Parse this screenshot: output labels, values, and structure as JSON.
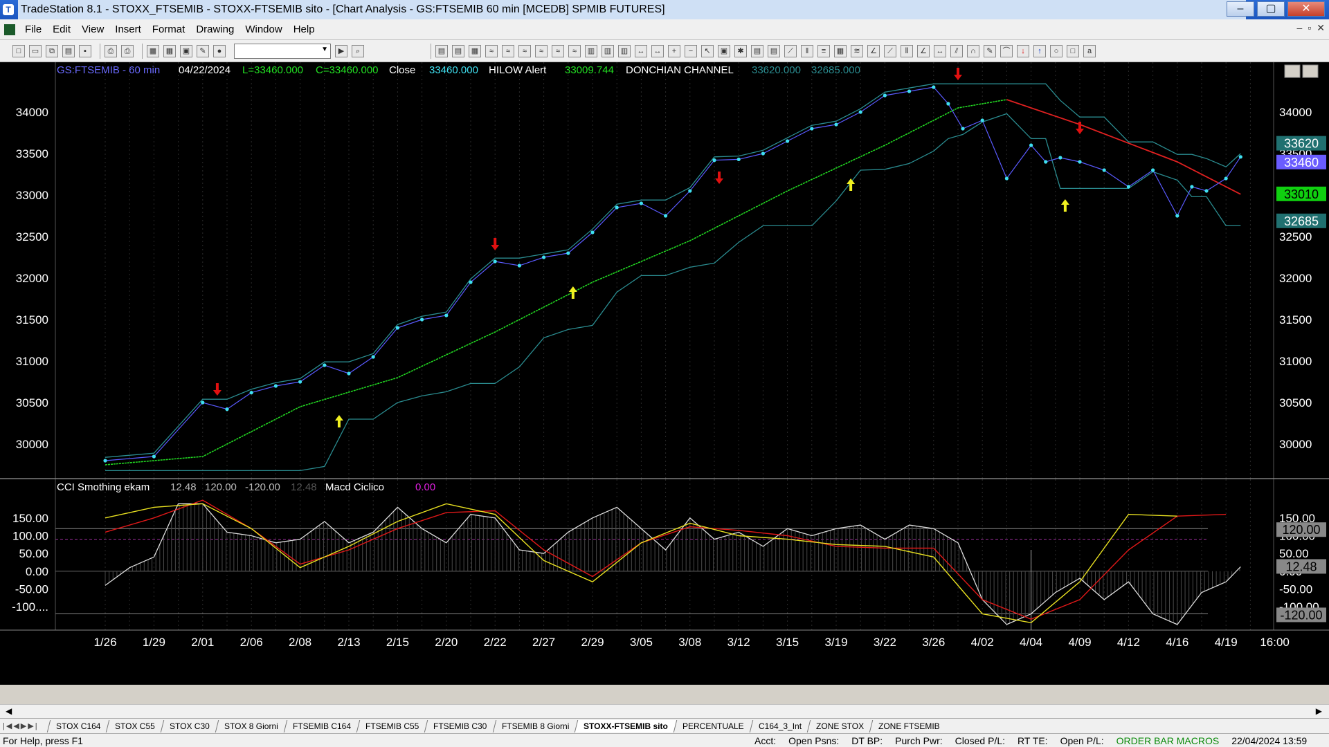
{
  "window": {
    "title": "TradeStation 8.1 - STOXX_FTSEMIB - STOXX-FTSEMIB sito - [Chart Analysis - GS:FTSEMIB  60 min  [MCEDB] SPMIB FUTURES]",
    "app_icon": "tradestation-icon"
  },
  "menu": [
    "File",
    "Edit",
    "View",
    "Insert",
    "Format",
    "Drawing",
    "Window",
    "Help"
  ],
  "price_panel": {
    "symbol": "GS:FTSEMIB - 60 min",
    "date": "04/22/2024",
    "low": "L=33460.000",
    "close_eq": "C=33460.000",
    "close_label": "Close",
    "close_val": "33460.000",
    "hilow_label": "HILOW Alert",
    "hilow_val": "33009.744",
    "donchian_label": "DONCHIAN CHANNEL",
    "donchian_hi": "33620.000",
    "donchian_lo": "32685.000",
    "badge_hi": "33620",
    "badge_close": "33460",
    "badge_ma": "33010",
    "badge_lo": "32685",
    "colors": {
      "price": "#3fe0f0",
      "ma_up": "#22d822",
      "ma_down": "#e02020",
      "channel": "#2a8c90",
      "badge_hi": "#207070",
      "badge_close": "#6a5cff",
      "badge_ma": "#10d010"
    }
  },
  "ind_panel": {
    "title": "CCI Smothing ekam",
    "v1": "12.48",
    "v2": "120.00",
    "v3": "-120.00",
    "v4": "12.48",
    "macd_label": "Macd Ciclico",
    "macd_val": "0.00",
    "badge_120": "120.00",
    "badge_cur": "12.48",
    "badge_m120": "-120.00"
  },
  "x_labels": [
    "1/26",
    "1/29",
    "2/01",
    "2/06",
    "2/08",
    "2/13",
    "2/15",
    "2/20",
    "2/22",
    "2/27",
    "2/29",
    "3/05",
    "3/08",
    "3/12",
    "3/15",
    "3/19",
    "3/22",
    "3/26",
    "4/02",
    "4/04",
    "4/09",
    "4/12",
    "4/16",
    "4/19",
    "16:00"
  ],
  "tabs": [
    "STOX C164",
    "STOX C55",
    "STOX  C30",
    "STOX  8 Giorni",
    "FTSEMIB C164",
    "FTSEMIB C55",
    "FTSEMIB C30",
    "FTSEMIB  8 Giorni",
    "STOXX-FTSEMIB sito",
    "PERCENTUALE",
    "C164_3_Int",
    "ZONE STOX",
    "ZONE FTSEMIB"
  ],
  "active_tab": "STOXX-FTSEMIB sito",
  "status": {
    "help": "For Help, press F1",
    "acct": "Acct:",
    "open_psns": "Open Psns:",
    "dt_bp": "DT BP:",
    "purch_pwr": "Purch Pwr:",
    "closed_pl": "Closed P/L:",
    "rt_te": "RT TE:",
    "open_pl": "Open P/L:",
    "macros": "ORDER BAR  MACROS",
    "datetime": "22/04/2024 13:59"
  },
  "chart_data": [
    {
      "type": "line",
      "title": "GS:FTSEMIB - 60 min",
      "y_ticks": [
        30000,
        30500,
        31000,
        31500,
        32000,
        32500,
        33000,
        33500,
        34000
      ],
      "ylim": [
        29600,
        34400
      ],
      "x_labels": [
        "1/26",
        "1/29",
        "2/01",
        "2/06",
        "2/08",
        "2/13",
        "2/15",
        "2/20",
        "2/22",
        "2/27",
        "2/29",
        "3/05",
        "3/08",
        "3/12",
        "3/15",
        "3/19",
        "3/22",
        "3/26",
        "4/02",
        "4/04",
        "4/09",
        "4/12",
        "4/16",
        "4/19",
        "16:00"
      ],
      "series": [
        {
          "name": "Close",
          "x": [
            0,
            1,
            2,
            2.5,
            3,
            3.5,
            4,
            4.5,
            5,
            5.5,
            6,
            6.5,
            7,
            7.5,
            8,
            8.5,
            9,
            9.5,
            10,
            10.5,
            11,
            11.5,
            12,
            12.5,
            13,
            13.5,
            14,
            14.5,
            15,
            15.5,
            16,
            16.5,
            17,
            17.3,
            17.6,
            18,
            18.5,
            19,
            19.3,
            19.6,
            20,
            20.5,
            21,
            21.5,
            22,
            22.3,
            22.6,
            23,
            23.3
          ],
          "values": [
            29800,
            29850,
            30500,
            30420,
            30620,
            30700,
            30750,
            30950,
            30850,
            31050,
            31400,
            31500,
            31550,
            31950,
            32200,
            32150,
            32250,
            32300,
            32550,
            32850,
            32900,
            32750,
            33050,
            33420,
            33430,
            33500,
            33650,
            33800,
            33850,
            34000,
            34200,
            34250,
            34300,
            34100,
            33800,
            33900,
            33200,
            33600,
            33400,
            33450,
            33400,
            33300,
            33100,
            33300,
            32750,
            33100,
            33050,
            33200,
            33460
          ]
        },
        {
          "name": "HILOW Alert",
          "x": [
            0,
            2,
            4,
            6,
            8,
            10,
            12,
            14,
            16,
            17.5,
            18.5,
            20,
            22,
            23.3
          ],
          "values": [
            29750,
            29850,
            30450,
            30800,
            31350,
            31950,
            32450,
            33050,
            33600,
            34050,
            34150,
            33850,
            33400,
            33010
          ]
        },
        {
          "name": "DONCHIAN CHANNEL",
          "x": [
            0,
            23.3
          ],
          "values": [
            33620,
            32685
          ]
        }
      ]
    },
    {
      "type": "line",
      "title": "CCI Smothing ekam",
      "y_ticks": [
        150,
        100,
        50,
        0,
        -50,
        -100
      ],
      "ylim": [
        -160,
        210
      ],
      "x_labels": [
        "1/26",
        "1/29",
        "2/01",
        "2/06",
        "2/08",
        "2/13",
        "2/15",
        "2/20",
        "2/22",
        "2/27",
        "2/29",
        "3/05",
        "3/08",
        "3/12",
        "3/15",
        "3/19",
        "3/22",
        "3/26",
        "4/02",
        "4/04",
        "4/09",
        "4/12",
        "4/16",
        "4/19",
        "16:00"
      ],
      "series": [
        {
          "name": "CCI",
          "x": [
            0,
            0.5,
            1,
            1.5,
            2,
            2.5,
            3,
            3.5,
            4,
            4.5,
            5,
            5.5,
            6,
            6.5,
            7,
            7.5,
            8,
            8.5,
            9,
            9.5,
            10,
            10.5,
            11,
            11.5,
            12,
            12.5,
            13,
            13.5,
            14,
            14.5,
            15,
            15.5,
            16,
            16.5,
            17,
            17.5,
            18,
            18.5,
            19,
            19.5,
            20,
            20.5,
            21,
            21.5,
            22,
            22.5,
            23,
            23.3
          ],
          "values": [
            -40,
            10,
            40,
            190,
            190,
            110,
            100,
            80,
            90,
            140,
            80,
            110,
            180,
            120,
            80,
            160,
            150,
            60,
            50,
            110,
            150,
            180,
            120,
            60,
            150,
            90,
            110,
            70,
            120,
            100,
            120,
            130,
            90,
            130,
            120,
            80,
            -80,
            -150,
            -120,
            -60,
            -20,
            -80,
            -30,
            -120,
            -150,
            -60,
            -30,
            12.48
          ]
        },
        {
          "name": "Smooth",
          "x": [
            0,
            1,
            2,
            3,
            4,
            5,
            6,
            7,
            8,
            9,
            10,
            11,
            12,
            13,
            14,
            15,
            16,
            17,
            18,
            19,
            20,
            21,
            22,
            23
          ],
          "values": [
            110,
            150,
            200,
            120,
            20,
            60,
            120,
            165,
            170,
            60,
            -15,
            80,
            125,
            115,
            100,
            70,
            65,
            65,
            -80,
            -135,
            -80,
            60,
            155,
            160
          ]
        },
        {
          "name": "Signal",
          "x": [
            0,
            1,
            2,
            3,
            4,
            5,
            6,
            7,
            8,
            9,
            10,
            11,
            12,
            13,
            14,
            15,
            16,
            17,
            18,
            19,
            20,
            21,
            22
          ],
          "values": [
            150,
            180,
            190,
            120,
            10,
            70,
            140,
            190,
            160,
            30,
            -30,
            80,
            135,
            100,
            90,
            75,
            70,
            40,
            -120,
            -145,
            -30,
            160,
            155
          ]
        }
      ]
    }
  ]
}
